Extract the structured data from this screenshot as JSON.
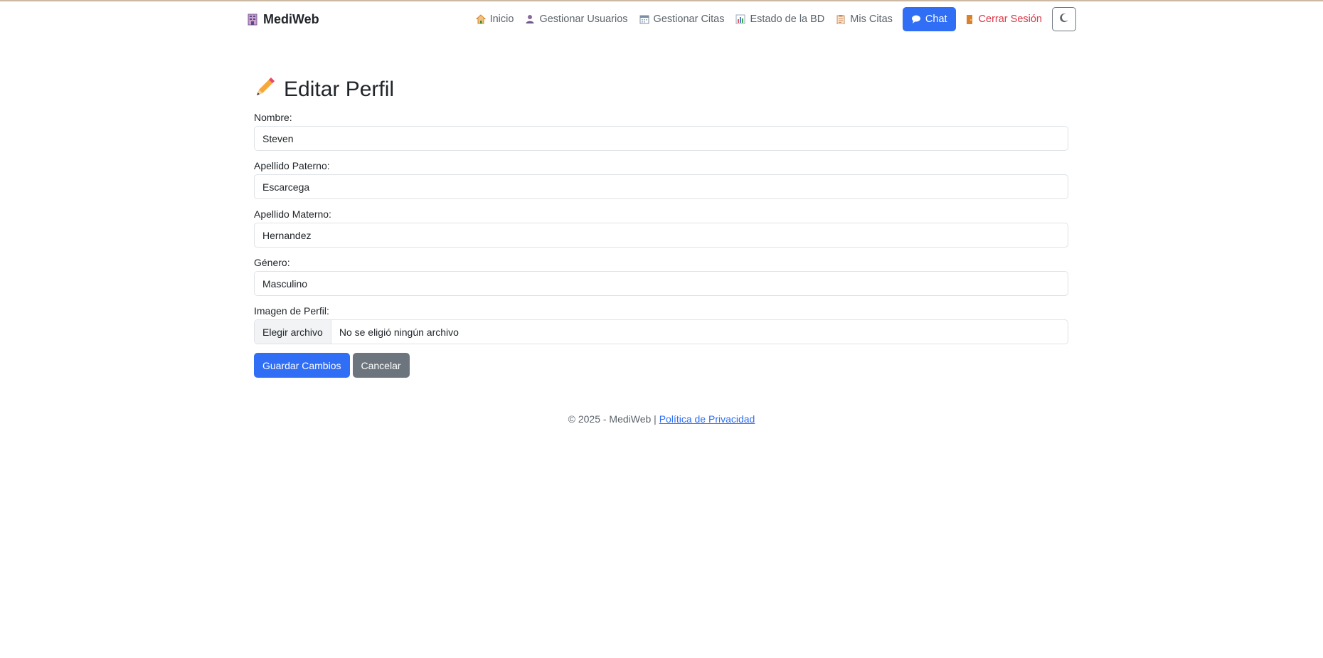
{
  "brand": {
    "name": "MediWeb",
    "icon": "hospital-icon"
  },
  "nav": {
    "items": [
      {
        "label": "Inicio",
        "icon": "house-icon"
      },
      {
        "label": "Gestionar Usuarios",
        "icon": "user-icon"
      },
      {
        "label": "Gestionar Citas",
        "icon": "calendar-icon"
      },
      {
        "label": "Estado de la BD",
        "icon": "bar-chart-icon"
      },
      {
        "label": "Mis Citas",
        "icon": "clipboard-icon"
      }
    ],
    "chat_label": "Chat",
    "logout_label": "Cerrar Sesión",
    "theme_toggle_icon": "moon-icon"
  },
  "page": {
    "title": "Editar Perfil",
    "title_icon": "pencil-icon"
  },
  "form": {
    "nombre": {
      "label": "Nombre:",
      "value": "Steven"
    },
    "apellido_paterno": {
      "label": "Apellido Paterno:",
      "value": "Escarcega"
    },
    "apellido_materno": {
      "label": "Apellido Materno:",
      "value": "Hernandez"
    },
    "genero": {
      "label": "Género:",
      "value": "Masculino"
    },
    "imagen": {
      "label": "Imagen de Perfil:",
      "button_label": "Elegir archivo",
      "status": "No se eligió ningún archivo"
    },
    "save_label": "Guardar Cambios",
    "cancel_label": "Cancelar"
  },
  "footer": {
    "text": "© 2025 - MediWeb |",
    "link_label": "Política de Privacidad"
  },
  "colors": {
    "primary": "#2f6ef5",
    "secondary": "#6c757d",
    "danger": "#dc3545"
  }
}
